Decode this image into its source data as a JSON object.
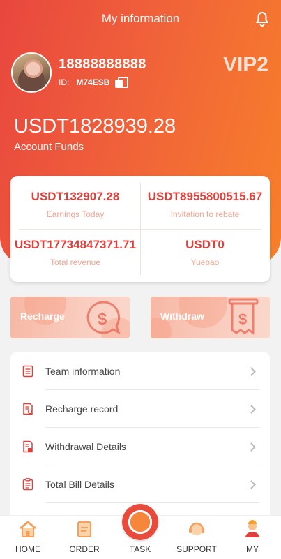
{
  "header": {
    "title": "My information"
  },
  "profile": {
    "phone": "18888888888",
    "id_label": "ID:",
    "id_value": "M74ESB",
    "vip": "VIP2"
  },
  "funds": {
    "amount": "USDT1828939.28",
    "label": "Account Funds"
  },
  "stats": [
    {
      "value": "USDT132907.28",
      "label": "Earnings Today"
    },
    {
      "value": "USDT8955800515.67",
      "label": "Invitation to rebate"
    },
    {
      "value": "USDT17734847371.71",
      "label": "Total revenue"
    },
    {
      "value": "USDT0",
      "label": "Yuebao"
    }
  ],
  "actions": {
    "recharge": "Recharge",
    "withdraw": "Withdraw"
  },
  "menu": [
    {
      "label": "Team information",
      "icon": "document-icon"
    },
    {
      "label": "Recharge record",
      "icon": "record-icon"
    },
    {
      "label": "Withdrawal Details",
      "icon": "withdraw-list-icon"
    },
    {
      "label": "Total Bill Details",
      "icon": "bill-icon"
    }
  ],
  "nav": [
    {
      "label": "HOME",
      "icon": "home-icon"
    },
    {
      "label": "ORDER",
      "icon": "order-icon"
    },
    {
      "label": "TASK",
      "icon": "task-icon"
    },
    {
      "label": "SUPPORT",
      "icon": "support-icon"
    },
    {
      "label": "MY",
      "icon": "user-icon"
    }
  ],
  "colors": {
    "accent": "#e0403a",
    "gradient_start": "#e8463e",
    "gradient_end": "#f7802a"
  }
}
